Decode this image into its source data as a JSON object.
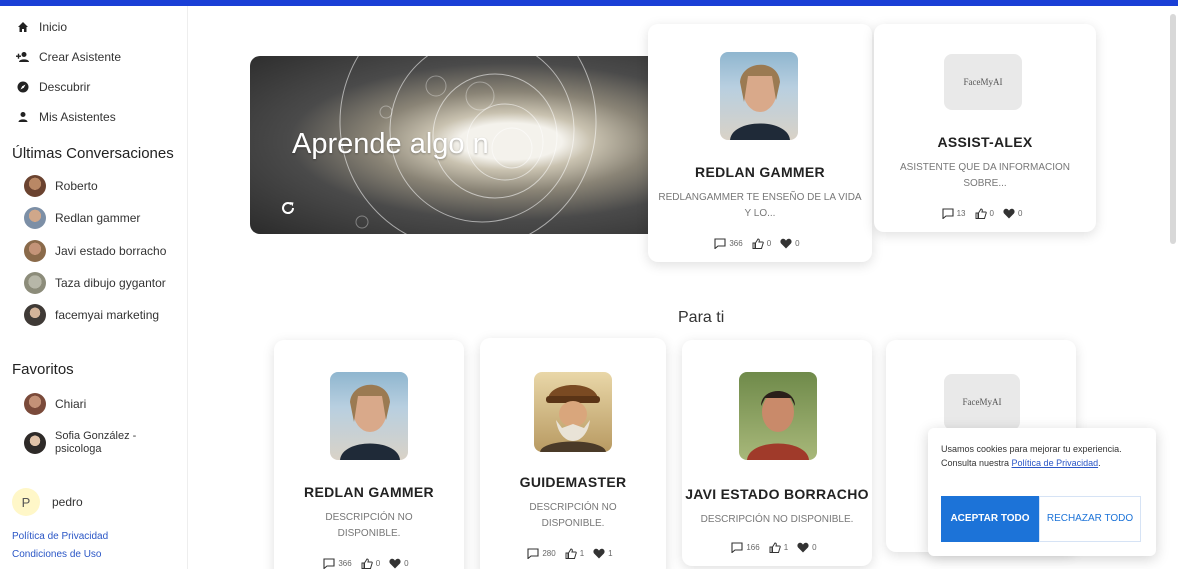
{
  "sidebar": {
    "nav": [
      {
        "label": "Inicio",
        "icon": "home-icon"
      },
      {
        "label": "Crear Asistente",
        "icon": "add-person-icon"
      },
      {
        "label": "Descubrir",
        "icon": "compass-icon"
      },
      {
        "label": "Mis Asistentes",
        "icon": "person-icon"
      }
    ],
    "recent_title": "Últimas Conversaciones",
    "recent": [
      {
        "label": "Roberto"
      },
      {
        "label": "Redlan gammer"
      },
      {
        "label": "Javi estado borracho"
      },
      {
        "label": "Taza dibujo gygantor"
      },
      {
        "label": "facemyai marketing"
      }
    ],
    "favorites_title": "Favoritos",
    "favorites": [
      {
        "label": "Chiari"
      },
      {
        "label": "Sofia González - psicologa"
      }
    ],
    "user": {
      "initial": "P",
      "name": "pedro"
    },
    "privacy_link": "Política de Privacidad",
    "terms_link": "Condiciones de Uso"
  },
  "hero": {
    "title": "Aprende algo n"
  },
  "featured": [
    {
      "name": "REDLAN GAMMER",
      "desc": "REDLANGAMMER TE ENSEÑO DE LA VIDA Y LO...",
      "comments": "366",
      "likes": "0",
      "hearts": "0"
    },
    {
      "name": "ASSIST-ALEX",
      "desc": "ASISTENTE QUE DA INFORMACION SOBRE...",
      "comments": "13",
      "likes": "0",
      "hearts": "0",
      "logo": "FaceMyAI"
    }
  ],
  "para_ti_title": "Para ti",
  "para_ti": [
    {
      "name": "REDLAN GAMMER",
      "desc": "DESCRIPCIÓN NO DISPONIBLE.",
      "comments": "366",
      "likes": "0",
      "hearts": "0"
    },
    {
      "name": "GUIDEMASTER",
      "desc": "DESCRIPCIÓN NO DISPONIBLE.",
      "comments": "280",
      "likes": "1",
      "hearts": "1"
    },
    {
      "name": "JAVI ESTADO BORRACHO",
      "desc": "DESCRIPCIÓN NO DISPONIBLE.",
      "comments": "166",
      "likes": "1",
      "hearts": "0"
    },
    {
      "logo": "FaceMyAI"
    }
  ],
  "cookie": {
    "text": "Usamos cookies para mejorar tu experiencia. Consulta nuestra ",
    "link": "Política de Privacidad",
    "after": ".",
    "accept": "ACEPTAR TODO",
    "reject": "RECHAZAR TODO"
  },
  "colors": {
    "topbar": "#1a3fd6",
    "accent": "#1c73d8",
    "link": "#2a56c6"
  }
}
